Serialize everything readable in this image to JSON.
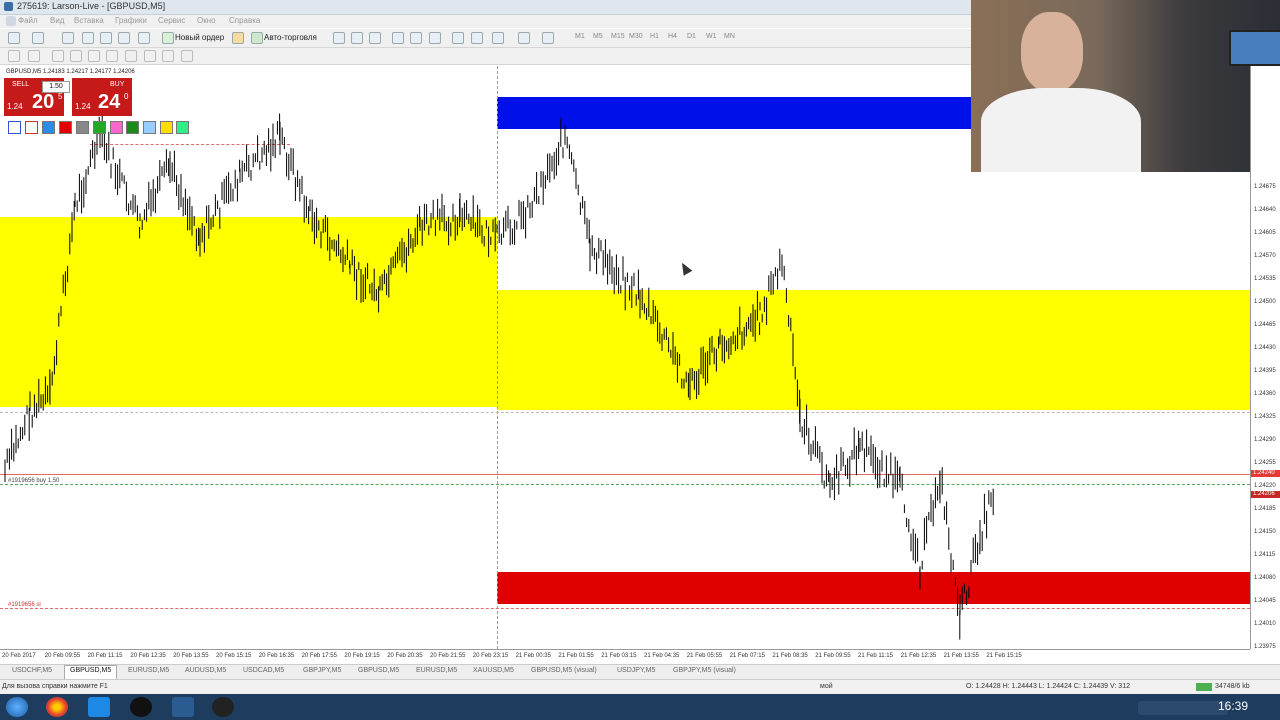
{
  "window": {
    "title": "275619: Larson-Live - [GBPUSD,M5]"
  },
  "menu": [
    "Файл",
    "Вид",
    "Вставка",
    "Графики",
    "Сервис",
    "Окно",
    "Справка"
  ],
  "toolbar": {
    "new_order": "Новый ордер",
    "autotrade": "Авто-торговля",
    "timeframes": [
      "M1",
      "M5",
      "M15",
      "M30",
      "H1",
      "H4",
      "D1",
      "W1",
      "MN"
    ]
  },
  "chart": {
    "symbol_header": "GBPUSD,M5  1.24183 1.24217 1.24177 1.24206",
    "accent_colors": {
      "yellow": "#ffff00",
      "blue": "#0010e8",
      "red": "#e00000"
    },
    "trade_panel": {
      "sell_label": "SELL",
      "buy_label": "BUY",
      "lot": "1.50",
      "sell_prefix": "1.24",
      "sell_big": "20",
      "sell_sup": "5",
      "buy_prefix": "1.24",
      "buy_big": "24",
      "buy_sup": "0"
    },
    "order_label_buy": "#1919656 buy 1.50",
    "order_label_sl": "#1919656 sl",
    "price_axis": [
      "1.24675",
      "1.24640",
      "1.24605",
      "1.24570",
      "1.24535",
      "1.24500",
      "1.24465",
      "1.24430",
      "1.24395",
      "1.24360",
      "1.24325",
      "1.24290",
      "1.24255",
      "1.24220",
      "1.24185",
      "1.24150",
      "1.24115",
      "1.24080",
      "1.24045",
      "1.24010",
      "1.23975"
    ],
    "price_tags": [
      "1.24240",
      "1.24206"
    ],
    "time_axis": [
      "20 Feb 2017",
      "20 Feb 09:55",
      "20 Feb 11:15",
      "20 Feb 12:35",
      "20 Feb 13:55",
      "20 Feb 15:15",
      "20 Feb 16:35",
      "20 Feb 17:55",
      "20 Feb 19:15",
      "20 Feb 20:35",
      "20 Feb 21:55",
      "20 Feb 23:15",
      "21 Feb 00:35",
      "21 Feb 01:55",
      "21 Feb 03:15",
      "21 Feb 04:35",
      "21 Feb 05:55",
      "21 Feb 07:15",
      "21 Feb 08:35",
      "21 Feb 09:55",
      "21 Feb 11:15",
      "21 Feb 12:35",
      "21 Feb 13:55",
      "21 Feb 15:15"
    ]
  },
  "tabs": [
    "USDCHF,M5",
    "GBPUSD,M5",
    "EURUSD,M5",
    "AUDUSD,M5",
    "USDCAD,M5",
    "GBPJPY,M5",
    "GBPUSD,M5",
    "EURUSD,M5",
    "XAUUSD,M5",
    "GBPUSD,M5 (visual)",
    "USDJPY,M5",
    "GBPJPY,M5 (visual)"
  ],
  "status": {
    "help": "Для вызова справки нажмите F1",
    "profile": "мой",
    "ohlc": "O: 1.24428   H: 1.24443   L: 1.24424   C: 1.24439   V: 312",
    "traffic": "34748/6 kb"
  },
  "taskbar": {
    "time": "16:39"
  }
}
